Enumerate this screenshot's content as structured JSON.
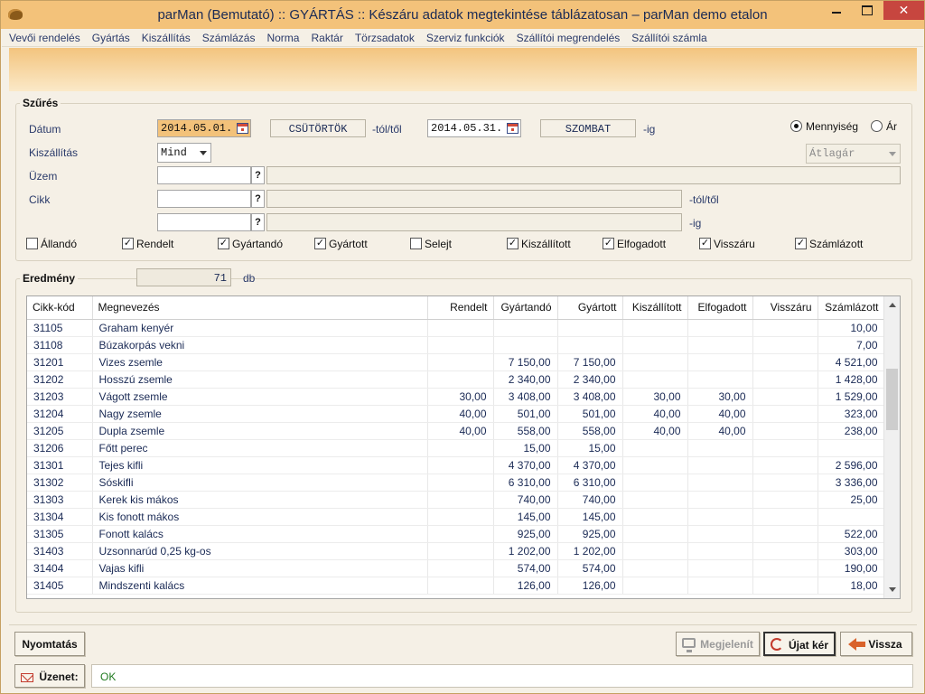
{
  "window": {
    "title": "parMan (Bemutató) :: GYÁRTÁS :: Készáru adatok megtekintése táblázatosan   –   parMan demo etalon",
    "close_glyph": "✕"
  },
  "menu": [
    "Vevői rendelés",
    "Gyártás",
    "Kiszállítás",
    "Számlázás",
    "Norma",
    "Raktár",
    "Törzsadatok",
    "Szerviz funkciók",
    "Szállítói megrendelés",
    "Szállítói számla"
  ],
  "filter": {
    "group_label": "Szűrés",
    "date_label": "Dátum",
    "date_from": "2014.05.01.",
    "day_from": "CSÜTÖRTÖK",
    "from_suffix": "-tól/től",
    "date_to": "2014.05.31.",
    "day_to": "SZOMBAT",
    "to_suffix": "-ig",
    "shipping_label": "Kiszállítás",
    "shipping_value": "Mind",
    "plant_label": "Üzem",
    "item_label": "Cikk",
    "item_from_suffix": "-tól/től",
    "item_to_suffix": "-ig",
    "lookup_glyph": "?",
    "radio_quantity": "Mennyiség",
    "radio_price": "Ár",
    "price_mode_value": "Átlagár",
    "checkboxes": [
      {
        "label": "Állandó",
        "checked": false
      },
      {
        "label": "Rendelt",
        "checked": true
      },
      {
        "label": "Gyártandó",
        "checked": true
      },
      {
        "label": "Gyártott",
        "checked": true
      },
      {
        "label": "Selejt",
        "checked": false
      },
      {
        "label": "Kiszállított",
        "checked": true
      },
      {
        "label": "Elfogadott",
        "checked": true
      },
      {
        "label": "Visszáru",
        "checked": true
      },
      {
        "label": "Számlázott",
        "checked": true
      }
    ],
    "check_glyph": "✓"
  },
  "result": {
    "group_label": "Eredmény",
    "count": "71",
    "count_unit": "db"
  },
  "table": {
    "columns": [
      "Cikk-kód",
      "Megnevezés",
      "Rendelt",
      "Gyártandó",
      "Gyártott",
      "Kiszállított",
      "Elfogadott",
      "Visszáru",
      "Számlázott"
    ],
    "rows": [
      [
        "31105",
        "Graham kenyér",
        "",
        "",
        "",
        "",
        "",
        "",
        "10,00"
      ],
      [
        "31108",
        "Búzakorpás vekni",
        "",
        "",
        "",
        "",
        "",
        "",
        "7,00"
      ],
      [
        "31201",
        "Vizes zsemle",
        "",
        "7 150,00",
        "7 150,00",
        "",
        "",
        "",
        "4 521,00"
      ],
      [
        "31202",
        "Hosszú zsemle",
        "",
        "2 340,00",
        "2 340,00",
        "",
        "",
        "",
        "1 428,00"
      ],
      [
        "31203",
        "Vágott zsemle",
        "30,00",
        "3 408,00",
        "3 408,00",
        "30,00",
        "30,00",
        "",
        "1 529,00"
      ],
      [
        "31204",
        "Nagy zsemle",
        "40,00",
        "501,00",
        "501,00",
        "40,00",
        "40,00",
        "",
        "323,00"
      ],
      [
        "31205",
        "Dupla zsemle",
        "40,00",
        "558,00",
        "558,00",
        "40,00",
        "40,00",
        "",
        "238,00"
      ],
      [
        "31206",
        "Főtt perec",
        "",
        "15,00",
        "15,00",
        "",
        "",
        "",
        ""
      ],
      [
        "31301",
        "Tejes kifli",
        "",
        "4 370,00",
        "4 370,00",
        "",
        "",
        "",
        "2 596,00"
      ],
      [
        "31302",
        "Sóskifli",
        "",
        "6 310,00",
        "6 310,00",
        "",
        "",
        "",
        "3 336,00"
      ],
      [
        "31303",
        "Kerek kis mákos",
        "",
        "740,00",
        "740,00",
        "",
        "",
        "",
        "25,00"
      ],
      [
        "31304",
        "Kis fonott mákos",
        "",
        "145,00",
        "145,00",
        "",
        "",
        "",
        ""
      ],
      [
        "31305",
        "Fonott kalács",
        "",
        "925,00",
        "925,00",
        "",
        "",
        "",
        "522,00"
      ],
      [
        "31403",
        "Uzsonnarúd 0,25 kg-os",
        "",
        "1 202,00",
        "1 202,00",
        "",
        "",
        "",
        "303,00"
      ],
      [
        "31404",
        "Vajas kifli",
        "",
        "574,00",
        "574,00",
        "",
        "",
        "",
        "190,00"
      ],
      [
        "31405",
        "Mindszenti kalács",
        "",
        "126,00",
        "126,00",
        "",
        "",
        "",
        "18,00"
      ]
    ]
  },
  "buttons": {
    "print": "Nyomtatás",
    "show": "Megjelenít",
    "new_request": "Újat kér",
    "back": "Vissza"
  },
  "status": {
    "label": "Üzenet:",
    "message": "OK"
  }
}
